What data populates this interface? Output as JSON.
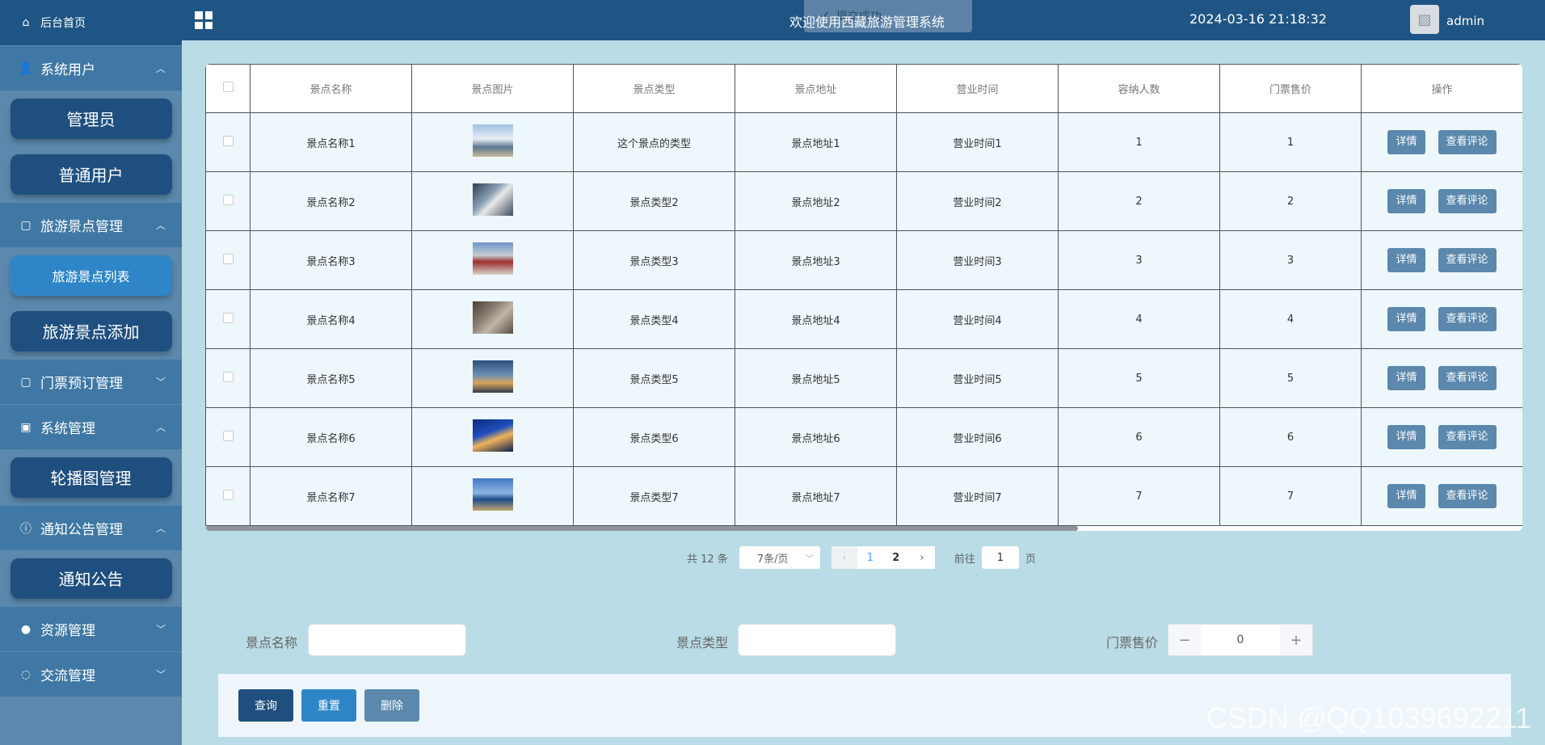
{
  "sidebar": {
    "home": "后台首页",
    "groups": [
      {
        "label": "系统用户",
        "chev": "^"
      },
      {
        "label": "旅游景点管理",
        "chev": "^"
      },
      {
        "label": "门票预订管理",
        "chev": "v"
      },
      {
        "label": "系统管理",
        "chev": "^"
      },
      {
        "label": "通知公告管理",
        "chev": "^"
      },
      {
        "label": "资源管理",
        "chev": "v"
      },
      {
        "label": "交流管理",
        "chev": "v"
      }
    ],
    "subs": [
      "管理员",
      "普通用户",
      "旅游景点列表",
      "旅游景点添加",
      "轮播图管理",
      "通知公告"
    ]
  },
  "topbar": {
    "title": "欢迎使用西藏旅游管理系统",
    "time": "2024-03-16 21:18:32",
    "user": "admin",
    "toast": "提交成功"
  },
  "table": {
    "headers": [
      "景点名称",
      "景点图片",
      "景点类型",
      "景点地址",
      "营业时间",
      "容纳人数",
      "门票售价",
      "操作"
    ],
    "rows": [
      {
        "name": "景点名称1",
        "type": "这个景点的类型",
        "addr": "景点地址1",
        "hours": "营业时间1",
        "cap": "1",
        "price": "1"
      },
      {
        "name": "景点名称2",
        "type": "景点类型2",
        "addr": "景点地址2",
        "hours": "营业时间2",
        "cap": "2",
        "price": "2"
      },
      {
        "name": "景点名称3",
        "type": "景点类型3",
        "addr": "景点地址3",
        "hours": "营业时间3",
        "cap": "3",
        "price": "3"
      },
      {
        "name": "景点名称4",
        "type": "景点类型4",
        "addr": "景点地址4",
        "hours": "营业时间4",
        "cap": "4",
        "price": "4"
      },
      {
        "name": "景点名称5",
        "type": "景点类型5",
        "addr": "景点地址5",
        "hours": "营业时间5",
        "cap": "5",
        "price": "5"
      },
      {
        "name": "景点名称6",
        "type": "景点类型6",
        "addr": "景点地址6",
        "hours": "营业时间6",
        "cap": "6",
        "price": "6"
      },
      {
        "name": "景点名称7",
        "type": "景点类型7",
        "addr": "景点地址7",
        "hours": "营业时间7",
        "cap": "7",
        "price": "7"
      }
    ],
    "detail_label": "详情",
    "review_label": "查看评论"
  },
  "pager": {
    "total": "共 12 条",
    "page_size": "7条/页",
    "page1": "1",
    "page2": "2",
    "goto_prefix": "前往",
    "goto_value": "1",
    "goto_suffix": "页"
  },
  "form": {
    "name_label": "景点名称",
    "type_label": "景点类型",
    "price_label": "门票售价",
    "price_value": "0"
  },
  "actions": {
    "query": "查询",
    "reset": "重置",
    "delete": "删除"
  },
  "watermark": "CSDN @QQ1039692211",
  "colors": {
    "sidebar_dark": "#1f5585",
    "accent": "#5b88ac",
    "active": "#2e86c8"
  }
}
